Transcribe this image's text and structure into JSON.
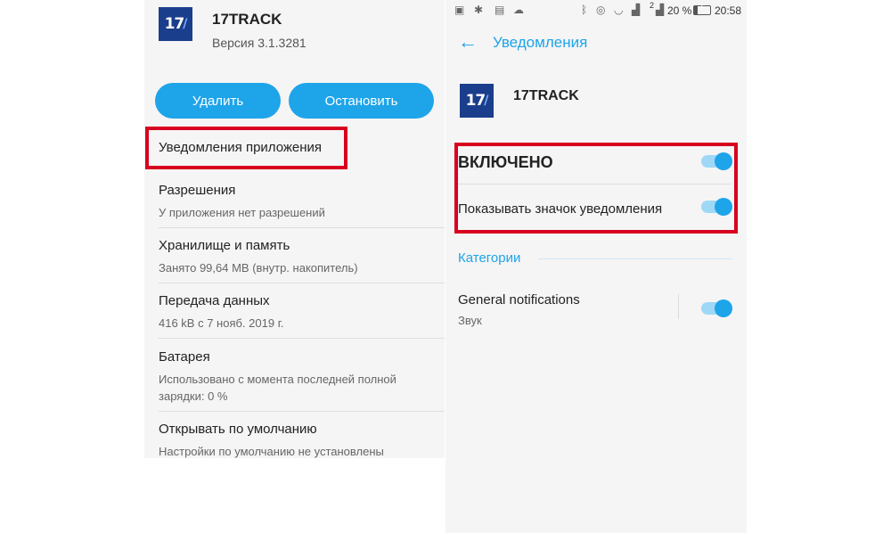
{
  "left": {
    "app_icon_text": "17",
    "app_name": "17TRACK",
    "version": "Версия 3.1.3281",
    "buttons": {
      "delete": "Удалить",
      "stop": "Остановить"
    },
    "notifications_item": "Уведомления приложения",
    "items": [
      {
        "title": "Разрешения",
        "subtitle": "У приложения нет разрешений"
      },
      {
        "title": "Хранилище и память",
        "subtitle": "Занято 99,64 MB (внутр. накопитель)"
      },
      {
        "title": "Передача данных",
        "subtitle": "416 kB с 7 нояб. 2019 г."
      },
      {
        "title": "Батарея",
        "subtitle": "Использовано с момента последней полной зарядки: 0 %"
      },
      {
        "title": "Открывать по умолчанию",
        "subtitle": "Настройки по умолчанию не установлены"
      }
    ]
  },
  "right": {
    "status_bar": {
      "battery": "20 %",
      "time": "20:58",
      "sim_badge": "2"
    },
    "title": "Уведомления",
    "app_icon_text": "17",
    "app_name": "17TRACK",
    "enabled_label": "ВКЛЮЧЕНО",
    "enabled_on": true,
    "badge_label": "Показывать значок уведомления",
    "badge_on": true,
    "categories_label": "Категории",
    "general": {
      "title": "General notifications",
      "subtitle": "Звук",
      "on": true
    }
  },
  "colors": {
    "accent": "#1ea4e9",
    "highlight": "#d8001f",
    "icon_bg": "#1b3e8c"
  }
}
